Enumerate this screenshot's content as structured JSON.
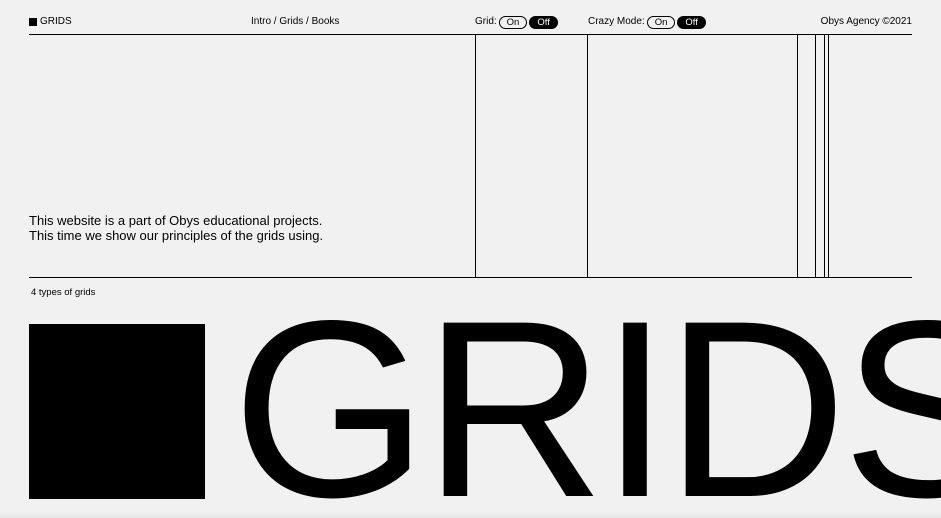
{
  "header": {
    "logo_label": "GRIDS",
    "breadcrumb": {
      "items": [
        "Intro",
        "Grids",
        "Books"
      ],
      "separator": " / "
    },
    "grid_toggle": {
      "label": "Grid:",
      "on_label": "On",
      "off_label": "Off",
      "active": "Off"
    },
    "crazy_toggle": {
      "label": "Crazy Mode:",
      "on_label": "On",
      "off_label": "Off",
      "active": "Off"
    },
    "copyright": "Obys Agency ©2021"
  },
  "intro": {
    "line1": "This website is a part of Obys educational projects.",
    "line2": "This time we show our principles of the grids using."
  },
  "types_label": "4 types of grids",
  "hero_title": "GRIDS",
  "colors": {
    "background": "#f1f1f1",
    "foreground": "#000000"
  }
}
